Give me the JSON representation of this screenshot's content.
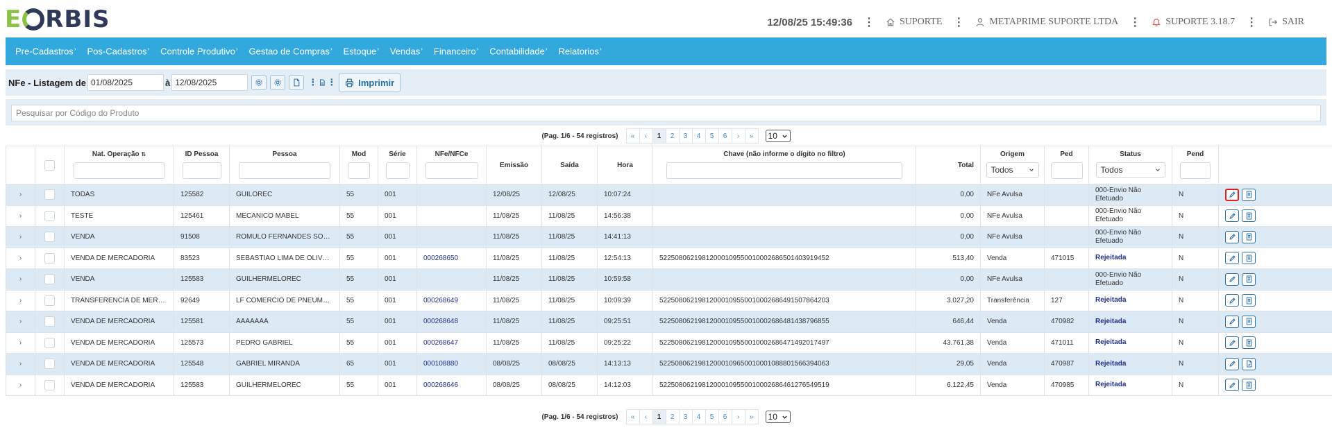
{
  "header": {
    "logo_e": "E",
    "logo_rest": "RBIS",
    "datetime": "12/08/25 15:49:36",
    "suporte": "SUPORTE",
    "company": "METAPRIME SUPORTE LTDA",
    "version": "SUPORTE 3.18.7",
    "logout": "SAIR"
  },
  "nav": {
    "items": [
      {
        "label": "Pre-Cadastros"
      },
      {
        "label": "Pos-Cadastros"
      },
      {
        "label": "Controle Produtivo"
      },
      {
        "label": "Gestao de Compras"
      },
      {
        "label": "Estoque"
      },
      {
        "label": "Vendas"
      },
      {
        "label": "Financeiro"
      },
      {
        "label": "Contabilidade"
      },
      {
        "label": "Relatorios"
      }
    ],
    "arrow": "›"
  },
  "toolbar": {
    "title": "NFe - Listagem de",
    "date_from": "01/08/2025",
    "separator": "à",
    "date_to": "12/08/2025",
    "print_label": "Imprimir"
  },
  "search": {
    "placeholder": "Pesquisar por Código do Produto"
  },
  "pagination": {
    "info": "(Pag. 1/6 - 54 registros)",
    "first": "«",
    "prev": "‹",
    "pages": [
      "1",
      "2",
      "3",
      "4",
      "5",
      "6"
    ],
    "next": "›",
    "last": "»",
    "page_size": "10",
    "current_page": 1
  },
  "table": {
    "columns": {
      "nat_operacao": "Nat. Operação",
      "sort_icon": "⇅",
      "id_pessoa": "ID Pessoa",
      "pessoa": "Pessoa",
      "mod": "Mod",
      "serie": "Série",
      "nfe": "NFe/NFCe",
      "emissao": "Emissão",
      "saida": "Saída",
      "hora": "Hora",
      "chave": "Chave (não informe o dígito no filtro)",
      "total": "Total",
      "origem": "Origem",
      "ped": "Ped",
      "status": "Status",
      "pend": "Pend"
    },
    "origem_filter": "Todos",
    "status_filter": "Todos",
    "rows": [
      {
        "nat": "TODAS",
        "id": "125582",
        "pessoa": "GUILOREC",
        "mod": "55",
        "serie": "001",
        "nfe": "",
        "emissao": "12/08/25",
        "saida": "12/08/25",
        "hora": "10:07:24",
        "chave": "",
        "total": "0,00",
        "origem": "NFe Avulsa",
        "ped": "",
        "status": "000-Envio Não Efetuado",
        "rejected": false,
        "pend": "N"
      },
      {
        "nat": "TESTE",
        "id": "125461",
        "pessoa": "MECANICO MABEL",
        "mod": "55",
        "serie": "001",
        "nfe": "",
        "emissao": "11/08/25",
        "saida": "11/08/25",
        "hora": "14:56:38",
        "chave": "",
        "total": "0,00",
        "origem": "NFe Avulsa",
        "ped": "",
        "status": "000-Envio Não Efetuado",
        "rejected": false,
        "pend": "N"
      },
      {
        "nat": "VENDA",
        "id": "91508",
        "pessoa": "ROMULO FERNANDES SOUTO",
        "mod": "55",
        "serie": "001",
        "nfe": "",
        "emissao": "11/08/25",
        "saida": "11/08/25",
        "hora": "14:41:13",
        "chave": "",
        "total": "0,00",
        "origem": "NFe Avulsa",
        "ped": "",
        "status": "000-Envio Não Efetuado",
        "rejected": false,
        "pend": "N"
      },
      {
        "nat": "VENDA DE MERCADORIA",
        "id": "83523",
        "pessoa": "SEBASTIAO LIMA DE OLIVEIRA",
        "mod": "55",
        "serie": "001",
        "nfe": "000268650",
        "emissao": "11/08/25",
        "saida": "11/08/25",
        "hora": "12:54:13",
        "chave": "52250806219812000109550010002686501403919452",
        "total": "513,40",
        "origem": "Venda",
        "ped": "471015",
        "status": "Rejeitada",
        "rejected": true,
        "pend": "N"
      },
      {
        "nat": "VENDA",
        "id": "125583",
        "pessoa": "GUILHERMELOREC",
        "mod": "55",
        "serie": "001",
        "nfe": "",
        "emissao": "11/08/25",
        "saida": "11/08/25",
        "hora": "10:59:58",
        "chave": "",
        "total": "0,00",
        "origem": "NFe Avulsa",
        "ped": "",
        "status": "000-Envio Não Efetuado",
        "rejected": false,
        "pend": "N"
      },
      {
        "nat": "TRANSFERENCIA DE MERCADORIA",
        "id": "92649",
        "pessoa": "LF COMERCIO DE PNEUMATICOS",
        "mod": "55",
        "serie": "001",
        "nfe": "000268649",
        "emissao": "11/08/25",
        "saida": "11/08/25",
        "hora": "10:09:39",
        "chave": "52250806219812000109550010002686491507864203",
        "total": "3.027,20",
        "origem": "Transferência",
        "ped": "127",
        "status": "Rejeitada",
        "rejected": true,
        "pend": "N"
      },
      {
        "nat": "VENDA DE MERCADORIA",
        "id": "125581",
        "pessoa": "AAAAAAA",
        "mod": "55",
        "serie": "001",
        "nfe": "000268648",
        "emissao": "11/08/25",
        "saida": "11/08/25",
        "hora": "09:25:51",
        "chave": "52250806219812000109550010002686481438796855",
        "total": "646,44",
        "origem": "Venda",
        "ped": "470982",
        "status": "Rejeitada",
        "rejected": true,
        "pend": "N"
      },
      {
        "nat": "VENDA DE MERCADORIA",
        "id": "125573",
        "pessoa": "PEDRO GABRIEL",
        "mod": "55",
        "serie": "001",
        "nfe": "000268647",
        "emissao": "11/08/25",
        "saida": "11/08/25",
        "hora": "09:25:22",
        "chave": "52250806219812000109550010002686471492017497",
        "total": "43.761,38",
        "origem": "Venda",
        "ped": "471011",
        "status": "Rejeitada",
        "rejected": true,
        "pend": "N"
      },
      {
        "nat": "VENDA DE MERCADORIA",
        "id": "125548",
        "pessoa": "GABRIEL MIRANDA",
        "mod": "65",
        "serie": "001",
        "nfe": "000108880",
        "emissao": "08/08/25",
        "saida": "08/08/25",
        "hora": "14:13:13",
        "chave": "52250806219812000109650010001088801566394063",
        "total": "29,05",
        "origem": "Venda",
        "ped": "470987",
        "status": "Rejeitada",
        "rejected": true,
        "pend": "N"
      },
      {
        "nat": "VENDA DE MERCADORIA",
        "id": "125583",
        "pessoa": "GUILHERMELOREC",
        "mod": "55",
        "serie": "001",
        "nfe": "000268646",
        "emissao": "08/08/25",
        "saida": "08/08/25",
        "hora": "14:12:03",
        "chave": "52250806219812000109550010002686461276549519",
        "total": "6.122,45",
        "origem": "Venda",
        "ped": "470985",
        "status": "Rejeitada",
        "rejected": true,
        "pend": "N"
      }
    ]
  },
  "icons": {
    "home": "home-icon",
    "user": "user-icon",
    "bell": "bell-icon",
    "logout": "logout-icon",
    "edit": "pencil-icon",
    "doc": "document-icon",
    "print": "printer-icon"
  },
  "colors": {
    "nav_bg": "#33a8dc",
    "row_alt": "#dbeaf5",
    "rejected": "#1f2f8f",
    "logo_green": "#8bc34a",
    "logo_navy": "#2e3a59"
  }
}
